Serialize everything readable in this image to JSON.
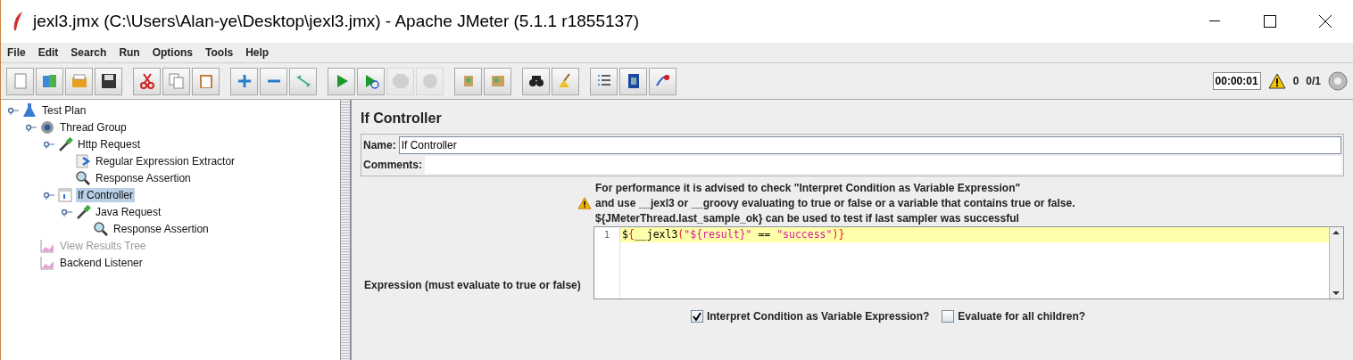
{
  "window": {
    "title": "jexl3.jmx (C:\\Users\\Alan-ye\\Desktop\\jexl3.jmx) - Apache JMeter (5.1.1 r1855137)"
  },
  "menu": [
    "File",
    "Edit",
    "Search",
    "Run",
    "Options",
    "Tools",
    "Help"
  ],
  "toolbar": [
    [
      {
        "kind": "new",
        "disabled": false
      },
      {
        "kind": "templates",
        "disabled": false
      },
      {
        "kind": "open",
        "disabled": false
      },
      {
        "kind": "save",
        "disabled": false
      }
    ],
    [
      {
        "kind": "cut",
        "disabled": false
      },
      {
        "kind": "copy",
        "disabled": false
      },
      {
        "kind": "paste",
        "disabled": false
      }
    ],
    [
      {
        "kind": "expand",
        "disabled": false
      },
      {
        "kind": "collapse",
        "disabled": false
      },
      {
        "kind": "toggle",
        "disabled": false
      }
    ],
    [
      {
        "kind": "start",
        "disabled": false
      },
      {
        "kind": "startnopause",
        "disabled": false
      },
      {
        "kind": "stop",
        "disabled": true
      },
      {
        "kind": "shutdown",
        "disabled": true
      }
    ],
    [
      {
        "kind": "clear",
        "disabled": false
      },
      {
        "kind": "clearall",
        "disabled": false
      }
    ],
    [
      {
        "kind": "search",
        "disabled": false
      },
      {
        "kind": "reset",
        "disabled": false
      }
    ],
    [
      {
        "kind": "functions",
        "disabled": false
      },
      {
        "kind": "help",
        "disabled": false
      },
      {
        "kind": "remote",
        "disabled": false
      }
    ]
  ],
  "status": {
    "timer": "00:00:01",
    "warnings": "0",
    "threads": "0/1"
  },
  "tree": [
    {
      "label": "Test Plan",
      "kind": "plan",
      "selected": false,
      "disabled": false,
      "children": [
        {
          "label": "Thread Group",
          "kind": "threads",
          "selected": false,
          "disabled": false,
          "children": [
            {
              "label": "Http Request",
              "kind": "sampler",
              "selected": false,
              "disabled": false,
              "children": [
                {
                  "label": "Regular Expression Extractor",
                  "kind": "extractor",
                  "selected": false,
                  "disabled": false
                },
                {
                  "label": "Response Assertion",
                  "kind": "assertion",
                  "selected": false,
                  "disabled": false
                }
              ]
            },
            {
              "label": "If Controller",
              "kind": "controller",
              "selected": true,
              "disabled": false,
              "children": [
                {
                  "label": "Java Request",
                  "kind": "sampler",
                  "selected": false,
                  "disabled": false,
                  "children": [
                    {
                      "label": "Response Assertion",
                      "kind": "assertion",
                      "selected": false,
                      "disabled": false
                    }
                  ]
                }
              ]
            }
          ]
        },
        {
          "label": "View Results Tree",
          "kind": "listener",
          "selected": false,
          "disabled": true
        },
        {
          "label": "Backend Listener",
          "kind": "listener",
          "selected": false,
          "disabled": false
        }
      ]
    }
  ],
  "panel": {
    "title": "If Controller",
    "name_label": "Name:",
    "name_value": "If Controller",
    "comments_label": "Comments:",
    "advice": [
      "For performance it is advised to check \"Interpret Condition as Variable Expression\"",
      "and use __jexl3 or __groovy evaluating to true or false or a variable that contains true or false.",
      "${JMeterThread.last_sample_ok} can be used to test if last sampler was successful"
    ],
    "expression_label": "Expression (must evaluate to true or false)",
    "editor": {
      "line_number": "1",
      "tokens": [
        {
          "text": "$",
          "kind": "plain"
        },
        {
          "text": "{",
          "kind": "brace"
        },
        {
          "text": "__jexl3",
          "kind": "plain"
        },
        {
          "text": "(",
          "kind": "brace"
        },
        {
          "text": "\"${result}\"",
          "kind": "string"
        },
        {
          "text": " == ",
          "kind": "plain"
        },
        {
          "text": "\"success\"",
          "kind": "string"
        },
        {
          "text": ")}",
          "kind": "brace"
        }
      ]
    },
    "options": [
      {
        "label": "Interpret Condition as Variable Expression?",
        "checked": true
      },
      {
        "label": "Evaluate for all children?",
        "checked": false
      }
    ]
  }
}
